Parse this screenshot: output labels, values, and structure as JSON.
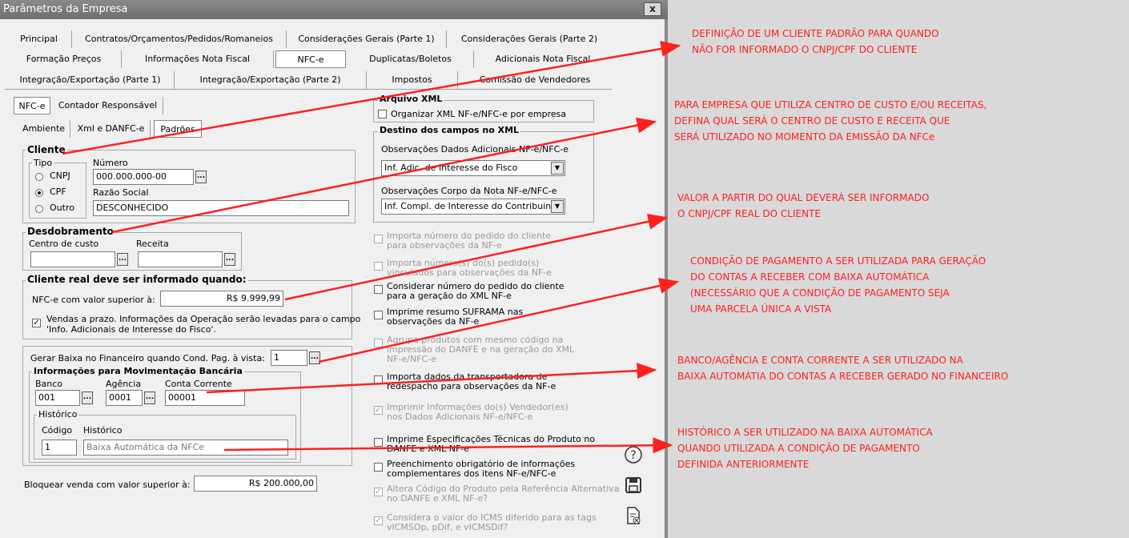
{
  "window": {
    "title": "Parâmetros da Empresa",
    "close_label": "x"
  },
  "tabs_row1": [
    "Principal",
    "Contratos/Orçamentos/Pedidos/Romaneios",
    "Considerações Gerais (Parte 1)",
    "Considerações Gerais (Parte 2)"
  ],
  "tabs_row2": [
    "Formação Preços",
    "Informações Nota Fiscal",
    "NFC-e",
    "Duplicatas/Boletos",
    "Adicionais Nota Fiscal"
  ],
  "tabs_row3": [
    "Integração/Exportação (Parte 1)",
    "Integração/Exportação (Parte 2)",
    "Impostos",
    "Comissão de Vendedores"
  ],
  "subtabs": [
    "NFC-e",
    "Contador Responsável"
  ],
  "subsubtabs": [
    "Ambiente",
    "Xml e DANFC-e",
    "Padrões"
  ],
  "cliente": {
    "title": "Cliente",
    "tipo_label": "Tipo",
    "options": [
      "CNPJ",
      "CPF",
      "Outro"
    ],
    "numero_label": "Número",
    "numero_value": "000.000.000-00",
    "razao_label": "Razão Social",
    "razao_value": "DESCONHECIDO",
    "ellipsis": "..."
  },
  "desdobramento": {
    "title": "Desdobramento",
    "centro_label": "Centro de custo",
    "receita_label": "Receita"
  },
  "cliente_real": {
    "title": "Cliente real deve ser informado quando:",
    "nfce_label": "NFC-e com valor superior à:",
    "nfce_value": "R$ 9.999,99",
    "vendas_text1": "Vendas a prazo. Informações da Operação serão levadas para o campo",
    "vendas_text2": "'Info. Adicionais de Interesse do Fisco'."
  },
  "baixa": {
    "label": "Gerar Baixa no Financeiro quando Cond. Pag. à vista:",
    "value": "1",
    "mov_title": "Informações para Movimentação Bancária",
    "banco_label": "Banco",
    "banco_value": "001",
    "agencia_label": "Agência",
    "agencia_value": "0001",
    "conta_label": "Conta Corrente",
    "conta_value": "00001",
    "historico_group": "Histórico",
    "codigo_label": "Código",
    "historico_label": "Histórico",
    "codigo_value": "1",
    "historico_value": "Baixa Automática da NFCe"
  },
  "bloquear": {
    "label": "Bloquear venda com valor superior à:",
    "value": "R$ 200.000,00"
  },
  "arquivo_xml": {
    "title": "Arquivo XML",
    "option": "Organizar XML NF-e/NFC-e por empresa"
  },
  "destino": {
    "title": "Destino dos campos no XML",
    "obs_label": "Observações Dados Adicionais NF-e/NFC-e",
    "obs_value": "Inf. Adic. de Interesse do Fisco",
    "corpo_label": "Observações Corpo da Nota NF-e/NFC-e",
    "corpo_value": "Inf. Compl. de Interesse do Contribuinte"
  },
  "options": [
    {
      "l1": "Importa número do pedido do cliente",
      "l2": "para observações da NF-e",
      "checked": false,
      "disabled": true
    },
    {
      "l1": "Importa número(s) do(s) pedido(s)",
      "l2": "vinculados para observações da NF-e",
      "checked": false,
      "disabled": true
    },
    {
      "l1": "Considerar número do pedido do cliente",
      "l2": "para a geração do XML NF-e",
      "checked": false,
      "disabled": false
    },
    {
      "l1": "Imprime resumo SUFRAMA nas",
      "l2": "observações da NF-e",
      "checked": false,
      "disabled": false
    },
    {
      "l1": "Agrupa produtos com  mesmo código na",
      "l2": "impressão do DANFE e na geração do XML",
      "l3": "NF-e/NFC-e",
      "checked": false,
      "disabled": true
    },
    {
      "l1": "Importa dados da transportadora de",
      "l2": "redespacho para observações da NF-e",
      "checked": false,
      "disabled": false
    },
    {
      "l1": "Imprimir Informações do(s) Vendedor(es)",
      "l2": "nos Dados Adicionais NF-e/NFC-e",
      "checked": true,
      "disabled": true
    },
    {
      "l1": "Imprime Especificações Técnicas do Produto no",
      "l2": "DANFE e XML NF-e",
      "checked": false,
      "disabled": false
    },
    {
      "l1": "Preenchimento obrigatório de informações",
      "l2": "complementares dos itens NF-e/NFC-e",
      "checked": false,
      "disabled": false
    },
    {
      "l1": "Altera Código do Produto pela Referência Alternativa",
      "l2": "no DANFE e XML NF-e?",
      "checked": true,
      "disabled": true
    },
    {
      "l1": "Considera o valor do ICMS diferido para as tags",
      "l2": "vICMSOp, pDif, e vICMSDif?",
      "checked": true,
      "disabled": true
    }
  ],
  "side_icons": [
    "help-icon",
    "save-icon",
    "cancel-document-icon"
  ],
  "annotations": [
    [
      "DEFINIÇÃO DE UM CLIENTE PADRÃO PARA QUANDO",
      "NÃO FOR INFORMADO O CNPJ/CPF DO CLIENTE"
    ],
    [
      "PARA EMPRESA QUE UTILIZA CENTRO DE CUSTO E/OU RECEITAS,",
      "DEFINA QUAL SERÁ O CENTRO DE CUSTO E RECEITA QUE",
      "SERÁ UTILIZADO NO MOMENTO DA EMISSÃO DA NFCe"
    ],
    [
      "VALOR A PARTIR DO QUAL DEVERÁ SER INFORMADO",
      "O CNPJ/CPF REAL DO CLIENTE"
    ],
    [
      "CONDIÇÃO DE PAGAMENTO A SER UTILIZADA PARA GERAÇÃO",
      "DO CONTAS A RECEBER COM BAIXA AUTOMÁTICA",
      "(NECESSÁRIO QUE A CONDIÇÃO DE PAGAMENTO SEJA",
      "UMA PARCELA ÚNICA A VISTA"
    ],
    [
      "BANCO/AGÊNCIA E CONTA CORRENTE A SER UTILIZADO NA",
      "BAIXA AUTOMÁTIA DO CONTAS A RECEBER GERADO NO FINANCEIRO"
    ],
    [
      "HISTÓRICO A SER UTILIZADO NA BAIXA AUTOMÁTICA",
      "QUANDO UTILIZADA A CONDIÇÃO DE PAGAMENTO",
      "DEFINIDA ANTERIORMENTE"
    ]
  ],
  "colors": {
    "annotation": "#ff2020",
    "titlebar": "#7a7a7a",
    "window": "#f0f0f0"
  }
}
